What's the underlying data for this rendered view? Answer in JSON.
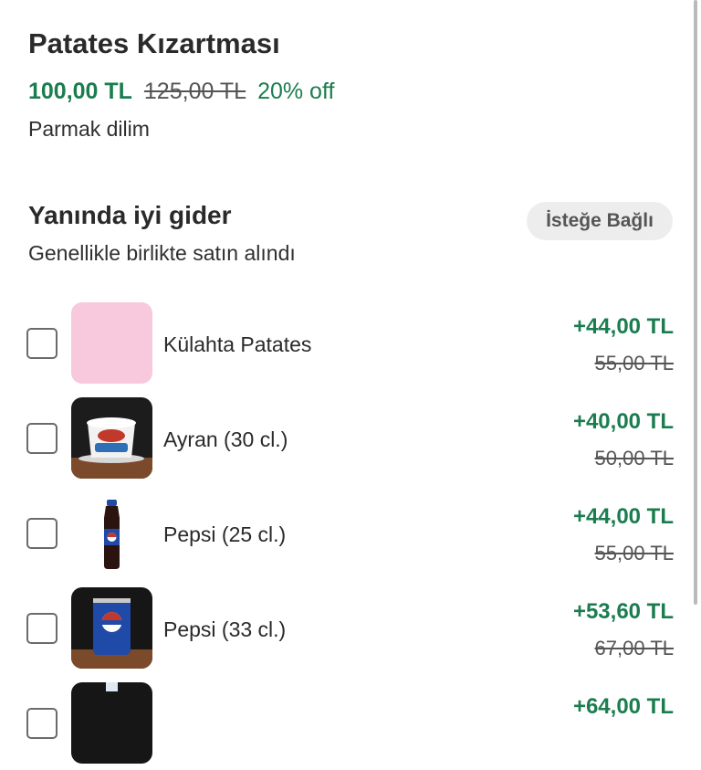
{
  "product": {
    "title": "Patates Kızartması",
    "price": "100,00 TL",
    "old_price": "125,00 TL",
    "discount": "20% off",
    "description": "Parmak dilim"
  },
  "section": {
    "title": "Yanında iyi gider",
    "subtitle": "Genellikle birlikte satın alındı",
    "badge": "İsteğe Bağlı"
  },
  "items": [
    {
      "name": "Külahta Patates",
      "price": "+44,00 TL",
      "old_price": "55,00 TL",
      "thumb": "pink-placeholder"
    },
    {
      "name": "Ayran (30 cl.)",
      "price": "+40,00 TL",
      "old_price": "50,00 TL",
      "thumb": "ayran-cup-photo"
    },
    {
      "name": "Pepsi (25 cl.)",
      "price": "+44,00 TL",
      "old_price": "55,00 TL",
      "thumb": "pepsi-bottle-photo"
    },
    {
      "name": "Pepsi (33 cl.)",
      "price": "+53,60 TL",
      "old_price": "67,00 TL",
      "thumb": "pepsi-can-photo"
    },
    {
      "name": "",
      "price": "+64,00 TL",
      "old_price": "",
      "thumb": "water-bottle-photo"
    }
  ],
  "colors": {
    "accent_green": "#1b7d4f",
    "badge_bg": "#ededed",
    "placeholder_pink": "#f8c8dc"
  }
}
